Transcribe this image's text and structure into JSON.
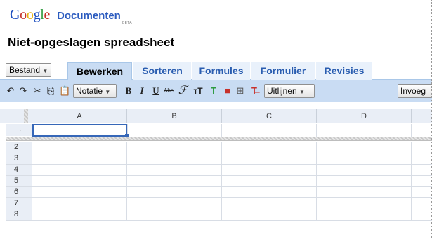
{
  "brand": {
    "google_letters": [
      {
        "ch": "G",
        "color": "#1b4dbf"
      },
      {
        "ch": "o",
        "color": "#c7312b"
      },
      {
        "ch": "o",
        "color": "#e8b10d"
      },
      {
        "ch": "g",
        "color": "#1b4dbf"
      },
      {
        "ch": "l",
        "color": "#2d9b3f"
      },
      {
        "ch": "e",
        "color": "#c7312b"
      }
    ],
    "product": "Documenten",
    "beta": "BETA"
  },
  "document": {
    "title": "Niet-opgeslagen spreadsheet"
  },
  "menu": {
    "file_label": "Bestand"
  },
  "tabs": [
    {
      "label": "Bewerken",
      "active": true
    },
    {
      "label": "Sorteren",
      "active": false
    },
    {
      "label": "Formules",
      "active": false
    },
    {
      "label": "Formulier",
      "active": false
    },
    {
      "label": "Revisies",
      "active": false
    }
  ],
  "toolbar": {
    "format_dropdown": "Notatie",
    "align_dropdown": "Uitlijnen",
    "insert_dropdown": "Invoeg",
    "icons": [
      "undo-icon",
      "redo-icon",
      "cut-icon",
      "copy-icon",
      "paste-icon",
      "bold-icon",
      "italic-icon",
      "underline-icon",
      "strikethrough-icon",
      "font-icon",
      "font-size-icon",
      "text-color-icon",
      "background-color-icon",
      "borders-icon",
      "clear-format-icon"
    ]
  },
  "grid": {
    "columns": [
      "A",
      "B",
      "C",
      "D"
    ],
    "frozen_row_marker": "·",
    "rows": [
      "2",
      "3",
      "4",
      "5",
      "6",
      "7",
      "8"
    ]
  },
  "colors": {
    "tab_active_bg": "#c9dcf3",
    "tab_inactive_bg": "#e9f1fb",
    "tab_inactive_text": "#2a5db0",
    "toolbar_bg": "#c9dcf3",
    "selection": "#3667b8"
  }
}
